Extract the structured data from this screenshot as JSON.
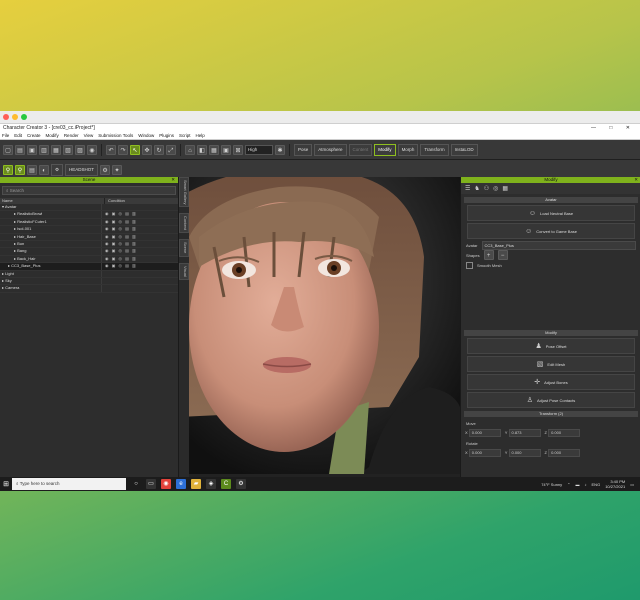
{
  "window": {
    "title": "Character Creator 3 - [cre03_cc.iProject*]"
  },
  "menu": [
    "File",
    "Edit",
    "Create",
    "Modify",
    "Render",
    "View",
    "Submission Tools",
    "Window",
    "Plugins",
    "Script",
    "Help"
  ],
  "toolbar": {
    "quality": "High",
    "pose_label": "Pose",
    "atmosphere_label": "Atmosphere",
    "content_label": "Content",
    "modify_label": "Modify",
    "morph_label": "Morph",
    "transform_label": "Transform",
    "install_label": "InstaLOD",
    "headshot_label": "HEADSHOT"
  },
  "scene": {
    "title": "Scene",
    "search_placeholder": "Search",
    "col_name": "Name",
    "col_condition": "Condition",
    "items": [
      {
        "label": "Avatar",
        "indent": 0,
        "arrow": "▾"
      },
      {
        "label": "RealisticBrowl",
        "indent": 2,
        "arrow": "▸"
      },
      {
        "label": "RealisticFCuter1",
        "indent": 2,
        "arrow": "▸"
      },
      {
        "label": "Isol-001",
        "indent": 2,
        "arrow": "▸"
      },
      {
        "label": "Hair_Base",
        "indent": 2,
        "arrow": "▸"
      },
      {
        "label": "Bun",
        "indent": 2,
        "arrow": "▸"
      },
      {
        "label": "Bang",
        "indent": 2,
        "arrow": "▸"
      },
      {
        "label": "Back_Hair",
        "indent": 2,
        "arrow": "▸"
      },
      {
        "label": "CC3_Base_Plus",
        "indent": 1,
        "arrow": "▸",
        "selected": true
      },
      {
        "label": "Light",
        "indent": 0,
        "arrow": "▸"
      },
      {
        "label": "Sky",
        "indent": 0,
        "arrow": "▸"
      },
      {
        "label": "Camera",
        "indent": 0,
        "arrow": "▸"
      }
    ]
  },
  "side_tabs": [
    "Smart Gallery",
    "Content",
    "Scene",
    "Visual"
  ],
  "modify": {
    "title": "Modify",
    "avatar_section": "Avatar",
    "load_neutral": "Load Neutral Base",
    "convert_game": "Convert to Game Base",
    "avatar_label": "Avatar",
    "avatar_value": "CC3_Base_Plus",
    "shapes_label": "Shapes",
    "smooth_mesh": "Smooth Mesh",
    "modify_section": "Modify",
    "pose_offset": "Pose Offset",
    "edit_mesh": "Edit Mesh",
    "adjust_bones": "Adjust Bones",
    "adjust_pose": "Adjust Pose Contacts",
    "transform_section": "Transform (2)",
    "move_label": "Move",
    "move_x": "0.000",
    "move_y": "0.873",
    "move_z": "0.000",
    "rotate_label": "Rotate",
    "rot_x": "0.000",
    "rot_y": "0.000",
    "rot_z": "0.000"
  },
  "taskbar": {
    "search_placeholder": "Type here to search",
    "weather": "74°F Sunny",
    "lang": "ENG",
    "time": "3:40 PM",
    "date": "10/27/2021"
  }
}
